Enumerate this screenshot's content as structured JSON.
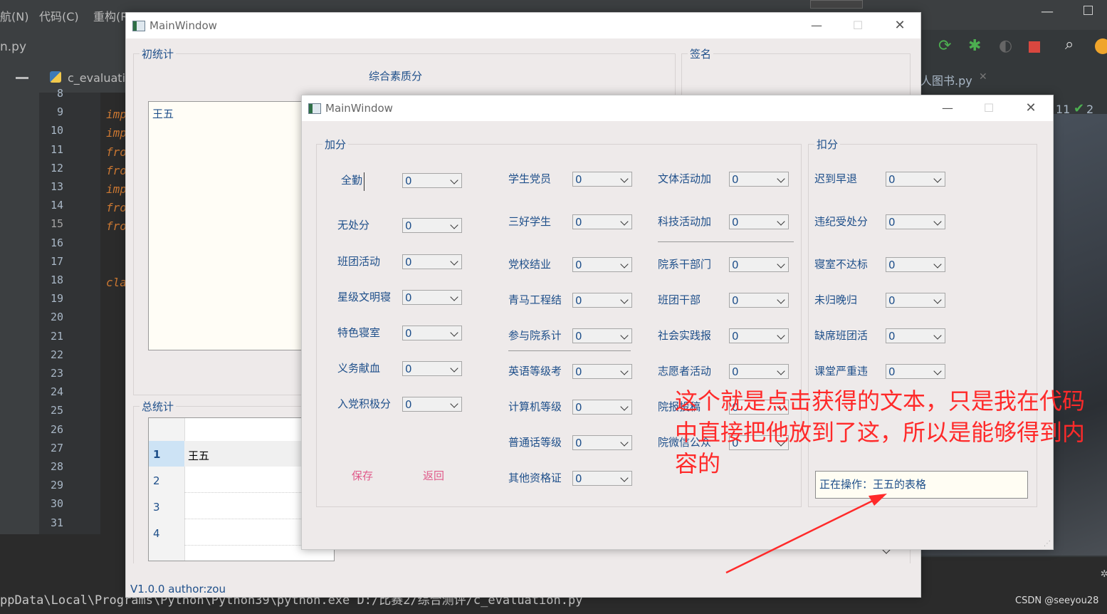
{
  "ide": {
    "menu": [
      "航(N)",
      "代码(C)",
      "重构(R)"
    ],
    "file_tab": "n.py",
    "editor_tab": "c_evaluatio",
    "line_numbers": [
      "8",
      "9",
      "10",
      "11",
      "12",
      "13",
      "14",
      "15",
      "16",
      "17",
      "18",
      "19",
      "20",
      "21",
      "22",
      "23",
      "24",
      "25",
      "26",
      "27",
      "28",
      "29",
      "30",
      "31"
    ],
    "code_fragments": [
      "imp",
      "imp",
      "fro",
      "fro",
      "imp",
      "fro",
      "fro",
      "cla"
    ],
    "right_tab": "人图书.py",
    "inspection_count": "11",
    "inspection_ok": "2",
    "terminal_line": "ppData\\Local\\Programs\\Python\\Python39\\python.exe D:/比赛2/综合测评/c_evaluation.py",
    "watermark": "CSDN @seeyou28"
  },
  "main_window": {
    "title": "MainWindow",
    "group_first": "初统计",
    "group_first_heading": "综合素质分",
    "list_item": "王五",
    "group_sign": "签名",
    "group_total": "总统计",
    "table_rows": [
      {
        "num": "1",
        "name": "王五"
      },
      {
        "num": "2",
        "name": ""
      },
      {
        "num": "3",
        "name": ""
      },
      {
        "num": "4",
        "name": ""
      }
    ],
    "footer": "V1.0.0  author:zou"
  },
  "sub_window": {
    "title": "MainWindow",
    "group_add": "加分",
    "group_deduct": "扣分",
    "add_col1": [
      "全勤",
      "无处分",
      "班团活动",
      "星级文明寝",
      "特色寝室",
      "义务献血",
      "入党积极分"
    ],
    "add_col2": [
      "学生党员",
      "三好学生",
      "党校结业",
      "青马工程结",
      "参与院系计",
      "英语等级考",
      "计算机等级",
      "普通话等级",
      "其他资格证"
    ],
    "add_col3": [
      "文体活动加",
      "科技活动加",
      "院系干部门",
      "班团干部",
      "社会实践报",
      "志愿者活动",
      "院报投稿",
      "院微信公众"
    ],
    "deduct": [
      "迟到早退",
      "违纪受处分",
      "寝室不达标",
      "未归晚归",
      "缺席班团活",
      "课堂严重违"
    ],
    "combo_value": "0",
    "save_button": "保存",
    "back_button": "返回",
    "operation_text": "正在操作：王五的表格"
  },
  "annotation": {
    "text": "这个就是点击获得的文本，只是我在代码中直接把他放到了这，所以是能够得到内容的",
    "color": "#ff2a2a"
  }
}
